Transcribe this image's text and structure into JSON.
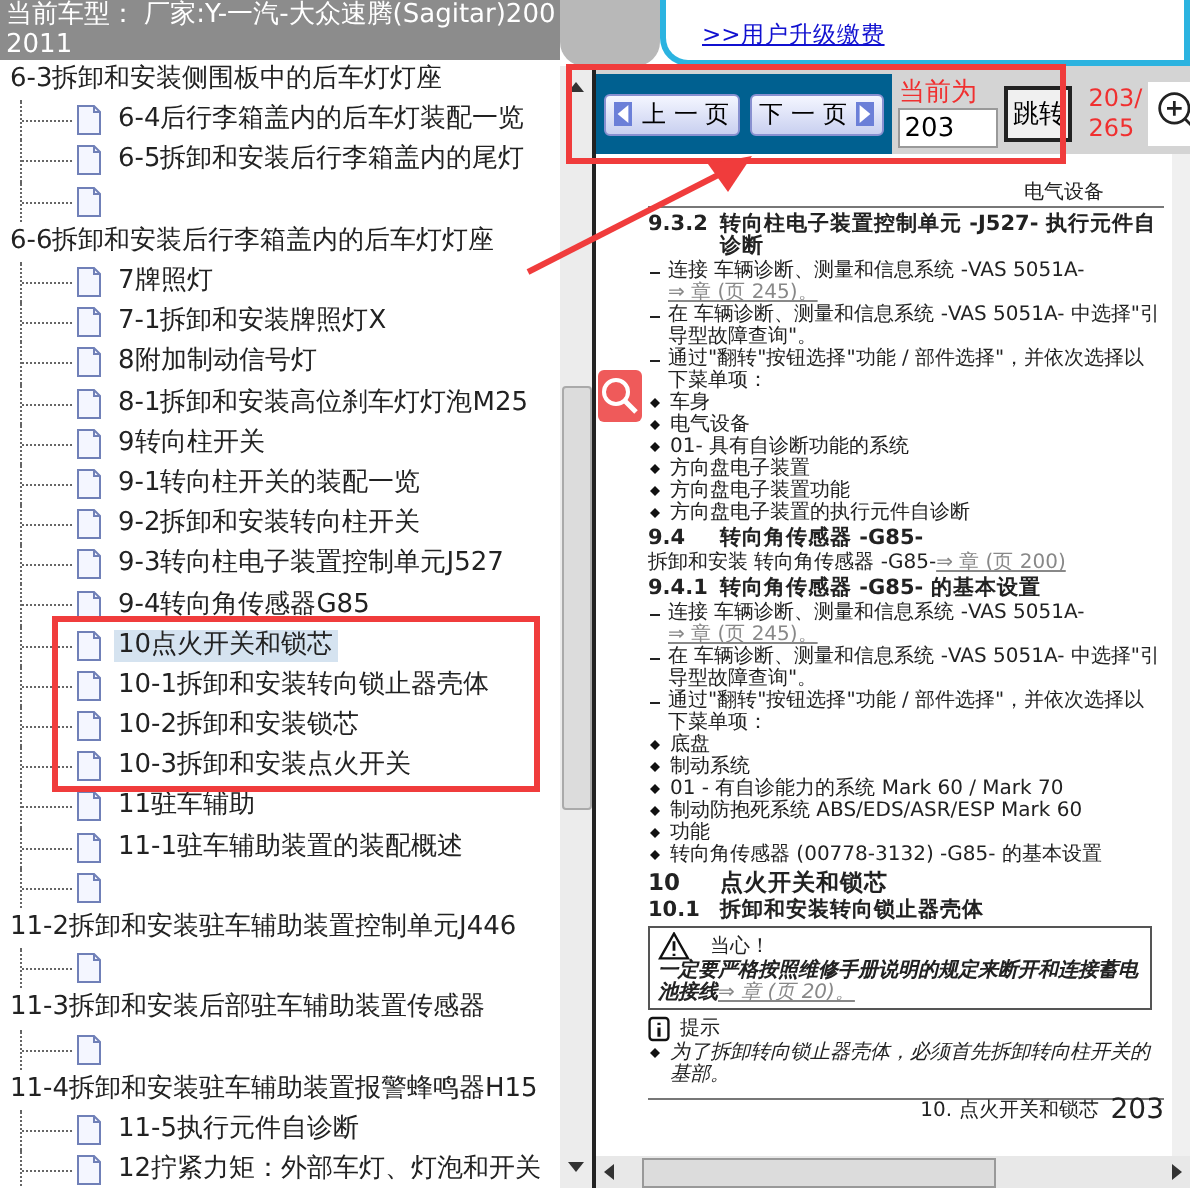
{
  "model_bar": {
    "lines": [
      "当前车型： 厂家:Y-一汽-大众速腾(Sagitar)200",
      "2011"
    ]
  },
  "banner": {
    "link": ">>用户升级缴费"
  },
  "tree": [
    {
      "label": "6-3拆卸和安装侧围板中的后车灯灯座",
      "selected": false,
      "children": [
        {
          "label": "6-4后行李箱盖内的后车灯装配一览",
          "selected": false
        },
        {
          "label": "6-5拆卸和安装后行李箱盖内的尾灯",
          "selected": false
        },
        {
          "selected": false
        }
      ]
    },
    {
      "label": "6-6拆卸和安装后行李箱盖内的后车灯灯座",
      "selected": false,
      "children": [
        {
          "label": "7牌照灯",
          "selected": false
        },
        {
          "label": "7-1拆卸和安装牌照灯X",
          "selected": false
        },
        {
          "label": "8附加制动信号灯",
          "selected": false
        },
        {
          "label": "8-1拆卸和安装高位刹车灯灯泡M25",
          "selected": false
        },
        {
          "label": "9转向柱开关",
          "selected": false
        },
        {
          "label": "9-1转向柱开关的装配一览",
          "selected": false
        },
        {
          "label": "9-2拆卸和安装转向柱开关",
          "selected": false
        },
        {
          "label": "9-3转向柱电子装置控制单元J527",
          "selected": false
        },
        {
          "label": "9-4转向角传感器G85",
          "selected": false
        },
        {
          "label": "10点火开关和锁芯",
          "selected": true
        },
        {
          "label": "10-1拆卸和安装转向锁止器壳体",
          "selected": false
        },
        {
          "label": "10-2拆卸和安装锁芯",
          "selected": false
        },
        {
          "label": "10-3拆卸和安装点火开关",
          "selected": false
        },
        {
          "label": "11驻车辅助",
          "selected": false
        },
        {
          "label": "11-1驻车辅助装置的装配概述",
          "selected": false
        },
        {
          "selected": false
        }
      ]
    },
    {
      "label": "11-2拆卸和安装驻车辅助装置控制单元J446",
      "selected": false,
      "children": [
        {
          "selected": false
        }
      ]
    },
    {
      "label": "11-3拆卸和安装后部驻车辅助装置传感器",
      "selected": false,
      "children": [
        {
          "selected": false
        }
      ]
    },
    {
      "label": "11-4拆卸和安装驻车辅助装置报警蜂鸣器H15",
      "selected": false,
      "children": [
        {
          "label": "11-5执行元件自诊断",
          "selected": false
        },
        {
          "label": "12拧紧力矩：外部车灯、灯泡和开关",
          "selected": false
        }
      ]
    }
  ],
  "pager": {
    "prev": "上 一 页",
    "next": "下 一 页",
    "current_label": "当前为",
    "page_input": "203",
    "go": "跳转",
    "page_count": [
      "203/",
      "265"
    ]
  },
  "document": {
    "header": "电气设备",
    "blocks": [
      {
        "kind": "heading",
        "number": "9.3.2",
        "text": "转向柱电子装置控制单元 -J527- 执行元件自诊断"
      },
      {
        "kind": "dash",
        "text": "连接 车辆诊断、测量和信息系统 -VAS 5051A-",
        "link": "⇒ 章 (页 245)。"
      },
      {
        "kind": "dash",
        "text": "在 车辆诊断、测量和信息系统 -VAS 5051A- 中选择\"引导型故障查询\"。"
      },
      {
        "kind": "dash",
        "text": "通过\"翻转\"按钮选择\"功能 / 部件选择\"，并依次选择以下菜单项："
      },
      {
        "kind": "bullet",
        "text": "车身"
      },
      {
        "kind": "bullet",
        "text": "电气设备"
      },
      {
        "kind": "bullet",
        "text": "01- 具有自诊断功能的系统"
      },
      {
        "kind": "bullet",
        "text": "方向盘电子装置"
      },
      {
        "kind": "bullet",
        "text": "方向盘电子装置功能"
      },
      {
        "kind": "bullet",
        "text": "方向盘电子装置的执行元件自诊断"
      },
      {
        "kind": "heading",
        "number": "9.4",
        "text": "转向角传感器 -G85-"
      },
      {
        "kind": "plain",
        "text": "拆卸和安装 转向角传感器 -G85-",
        "link": "⇒ 章 (页 200)"
      },
      {
        "kind": "heading",
        "number": "9.4.1",
        "text": "转向角传感器 -G85- 的基本设置"
      },
      {
        "kind": "dash",
        "text": "连接 车辆诊断、测量和信息系统 -VAS 5051A-",
        "link": "⇒ 章 (页 245)。"
      },
      {
        "kind": "dash",
        "text": "在 车辆诊断、测量和信息系统 -VAS 5051A- 中选择\"引导型故障查询\"。"
      },
      {
        "kind": "dash",
        "text": "通过\"翻转\"按钮选择\"功能 / 部件选择\"，并依次选择以下菜单项："
      },
      {
        "kind": "bullet",
        "text": "底盘"
      },
      {
        "kind": "bullet",
        "text": "制动系统"
      },
      {
        "kind": "bullet",
        "text": "01 - 有自诊能力的系统 Mark 60 / Mark 70"
      },
      {
        "kind": "bullet",
        "text": "制动防抱死系统 ABS/EDS/ASR/ESP Mark 60"
      },
      {
        "kind": "bullet",
        "text": "功能"
      },
      {
        "kind": "bullet",
        "text": "转向角传感器 (00778-3132) -G85- 的基本设置"
      },
      {
        "kind": "major",
        "number": "10",
        "text": "点火开关和锁芯"
      },
      {
        "kind": "heading",
        "number": "10.1",
        "text": "拆卸和安装转向锁止器壳体"
      },
      {
        "kind": "caution",
        "title": "当心！",
        "text": "一定要严格按照维修手册说明的规定来断开和连接蓄电池接线",
        "link": "⇒ 章 (页 20)。"
      },
      {
        "kind": "note",
        "title": "提示"
      },
      {
        "kind": "bullet",
        "text": "为了拆卸转向锁止器壳体，必须首先拆卸转向柱开关的基部。",
        "italic": true
      }
    ],
    "footer_title": "10. 点火开关和锁芯",
    "page_number": "203"
  }
}
